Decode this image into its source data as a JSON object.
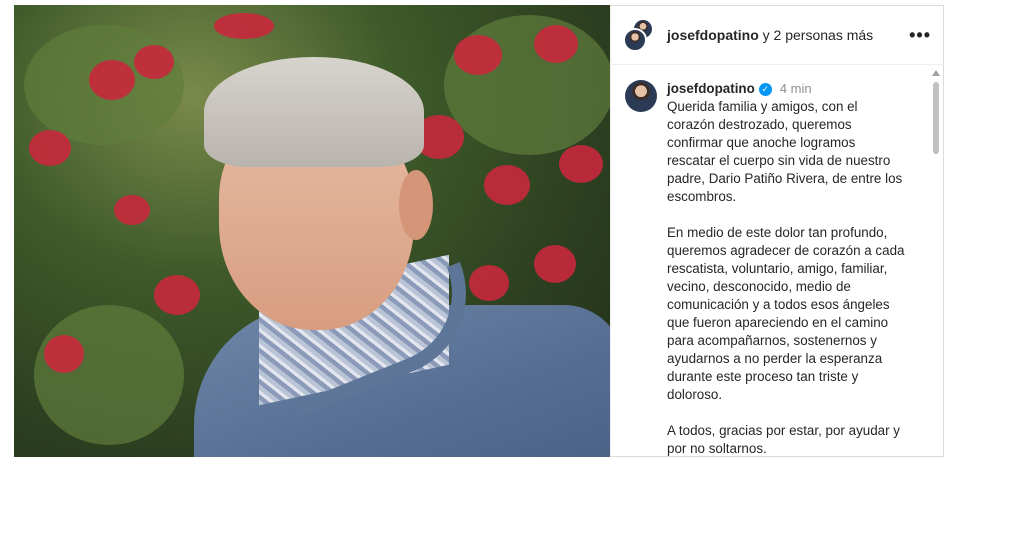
{
  "header": {
    "username": "josefdopatino",
    "others_text": " y 2 personas más",
    "more_icon": "more-horizontal-icon"
  },
  "caption": {
    "username": "josefdopatino",
    "verified_icon": "verified-badge-icon",
    "time": "4 min",
    "paragraphs": [
      "Querida familia y amigos, con el\ncorazón destrozado, queremos\nconfirmar que anoche logramos\nrescatar el cuerpo sin vida de nuestro\npadre, Dario Patiño Rivera, de entre los\nescombros.",
      "En medio de este dolor tan profundo,\nqueremos agradecer de corazón a cada\nrescatista, voluntario, amigo, familiar,\nvecino, desconocido, medio de\ncomunicación y a todos esos ángeles\nque fueron apareciendo en el camino\npara acompañarnos, sostenernos y\nayudarnos a no perder la esperanza\ndurante este proceso tan triste y\ndoloroso.",
      "A todos, gracias por estar, por ayudar y\npor no soltarnos."
    ]
  },
  "colors": {
    "verified": "#0095f6",
    "text": "#262626",
    "muted": "#8e8e8e",
    "flower": "#c8283c"
  }
}
